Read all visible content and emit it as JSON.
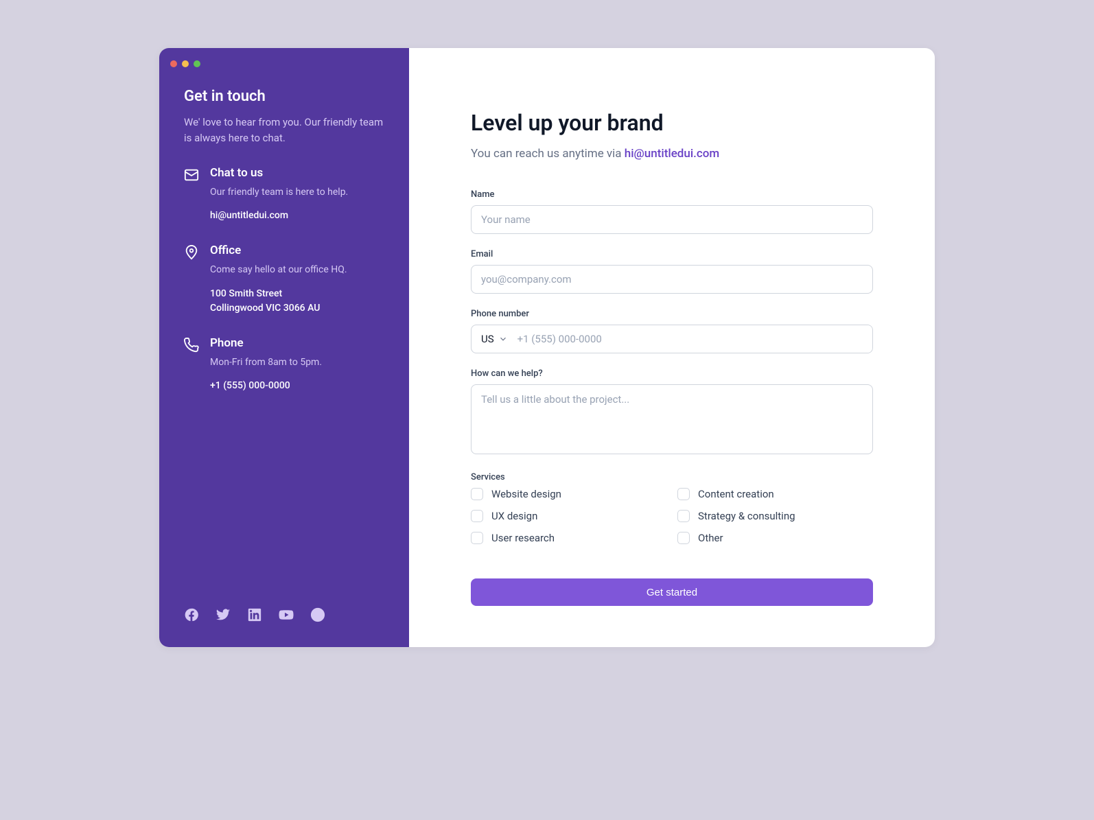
{
  "sidebar": {
    "title": "Get in touch",
    "intro": "We' love to hear from you. Our friendly team is always here to chat.",
    "chat": {
      "title": "Chat to us",
      "subtext": "Our friendly team is here to help.",
      "email": "hi@untitledui.com"
    },
    "office": {
      "title": "Office",
      "subtext": "Come say hello at our office HQ.",
      "line1": "100 Smith Street",
      "line2": "Collingwood VIC 3066 AU"
    },
    "phone": {
      "title": "Phone",
      "subtext": "Mon-Fri from 8am to 5pm.",
      "number": "+1 (555) 000-0000"
    }
  },
  "form": {
    "heading": "Level up your brand",
    "lead_prefix": "You can reach us anytime via ",
    "lead_email": "hi@untitledui.com",
    "name_label": "Name",
    "name_placeholder": "Your name",
    "email_label": "Email",
    "email_placeholder": "you@company.com",
    "phone_label": "Phone number",
    "phone_country": "US",
    "phone_placeholder": "+1 (555) 000-0000",
    "help_label": "How can we help?",
    "help_placeholder": "Tell us a little about the project...",
    "services_label": "Services",
    "services": [
      "Website design",
      "Content creation",
      "UX design",
      "Strategy & consulting",
      "User research",
      "Other"
    ],
    "submit_label": "Get started"
  }
}
